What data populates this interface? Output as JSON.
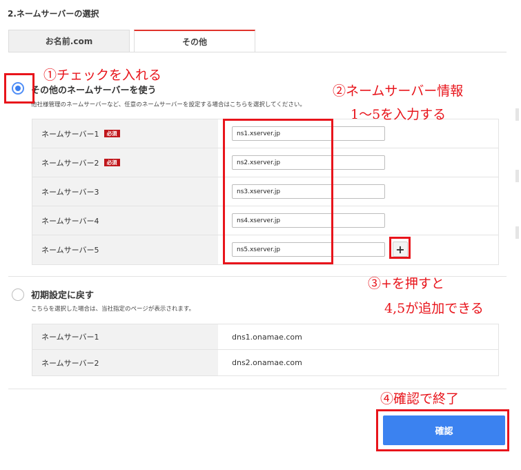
{
  "section_title": "2.ネームサーバーの選択",
  "tabs": [
    {
      "label": "お名前.com"
    },
    {
      "label": "その他"
    }
  ],
  "option_other": {
    "label": "その他のネームサーバーを使う",
    "description": "他社様管理のネームサーバーなど、任意のネームサーバーを設定する場合はこちらを選択してください。"
  },
  "required_badge": "必須",
  "nameservers": [
    {
      "label": "ネームサーバー1",
      "value": "ns1.xserver.jp"
    },
    {
      "label": "ネームサーバー2",
      "value": "ns2.xserver.jp"
    },
    {
      "label": "ネームサーバー3",
      "value": "ns3.xserver.jp"
    },
    {
      "label": "ネームサーバー4",
      "value": "ns4.xserver.jp"
    },
    {
      "label": "ネームサーバー5",
      "value": "ns5.xserver.jp"
    }
  ],
  "add_button": "+",
  "option_default": {
    "label": "初期設定に戻す",
    "description": "こちらを選択した場合は、当社指定のページが表示されます。"
  },
  "default_nameservers": [
    {
      "label": "ネームサーバー1",
      "value": "dns1.onamae.com"
    },
    {
      "label": "ネームサーバー2",
      "value": "dns2.onamae.com"
    }
  ],
  "confirm_label": "確認",
  "annotations": {
    "step1": "①チェックを入れる",
    "step2_line1": "②ネームサーバー情報",
    "step2_line2": "1～5を入力する",
    "step3_line1": "③+を押すと",
    "step3_line2": "4,5が追加できる",
    "step4": "④確認で終了"
  },
  "colors": {
    "accent_blue": "#3b82f0",
    "annotation_red": "#e8141b",
    "badge_red": "#c0161b"
  }
}
